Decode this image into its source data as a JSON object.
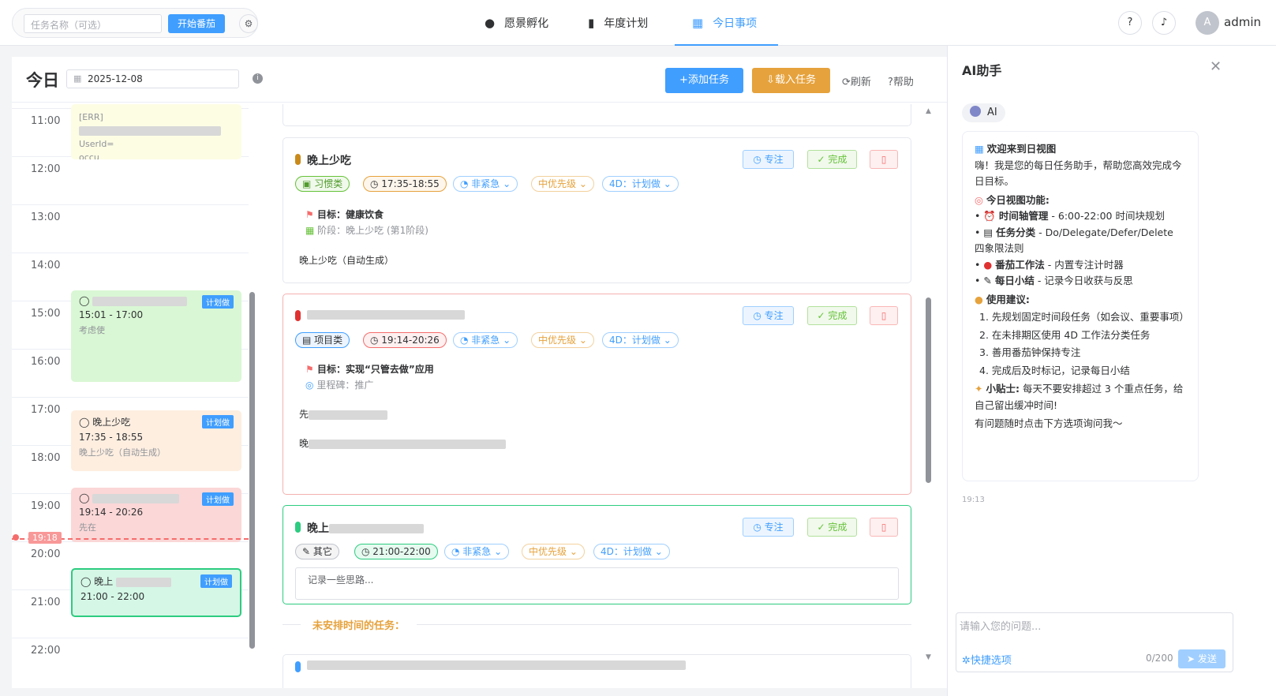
{
  "topbar": {
    "task_placeholder": "任务名称（可选）",
    "start_button": "开始番茄",
    "nav": [
      {
        "label": "愿景孵化",
        "icon": "bulb-icon"
      },
      {
        "label": "年度计划",
        "icon": "clipboard-icon"
      },
      {
        "label": "今日事项",
        "icon": "calendar-icon"
      }
    ],
    "help_icon": "?",
    "bell_icon": "🔔",
    "avatar": "A",
    "username": "admin"
  },
  "header": {
    "title": "今日",
    "date": "2025-12-08",
    "add_task": "+添加任务",
    "load_task": "⇩载入任务",
    "refresh": "刷新",
    "help": "帮助"
  },
  "timeline": {
    "hours": [
      "11:00",
      "12:00",
      "13:00",
      "14:00",
      "15:00",
      "16:00",
      "17:00",
      "18:00",
      "19:00",
      "20:00",
      "21:00",
      "22:00"
    ],
    "now": "19:18",
    "events": [
      {
        "title": "[ERR]",
        "time": "UserId=",
        "desc": "occu",
        "badge": ""
      },
      {
        "title": "",
        "time": "15:01 - 17:00",
        "desc": "考虑使",
        "badge": "计划做"
      },
      {
        "title": "晚上少吃",
        "time": "17:35 - 18:55",
        "desc": "晚上少吃（自动生成）",
        "badge": "计划做"
      },
      {
        "title": "",
        "time": "19:14 - 20:26",
        "desc": "先在",
        "badge": "计划做"
      },
      {
        "title": "晚上",
        "time": "21:00 - 22:00",
        "desc": "",
        "badge": "计划做"
      }
    ]
  },
  "cards": [
    {
      "title": "晚上少吃",
      "cat": "习惯类",
      "time": "17:35-18:55",
      "urg": "非紧急",
      "pri": "中优先级",
      "d4": "4D：计划做",
      "goal": "目标：健康饮食",
      "sub": "阶段：晚上少吃 (第1阶段)",
      "desc": "晚上少吃（自动生成）"
    },
    {
      "title": "",
      "cat": "项目类",
      "time": "19:14-20:26",
      "urg": "非紧急",
      "pri": "中优先级",
      "d4": "4D：计划做",
      "goal": "目标：实现“只管去做”应用",
      "sub": "里程碑：推广",
      "desc": "先",
      "desc2": "晚"
    },
    {
      "title": "晚上",
      "cat": "其它",
      "time": "21:00-22:00",
      "urg": "非紧急",
      "pri": "中优先级",
      "d4": "4D：计划做",
      "placeholder": "记录一些思路..."
    }
  ],
  "actions": {
    "focus": "专注",
    "done": "完成",
    "delete_icon": "🗑"
  },
  "unscheduled": "未安排时间的任务：",
  "ai": {
    "title": "AI助手",
    "badge": "AI",
    "time": "19:13",
    "input_placeholder": "请输入您的问题...",
    "quick": "快捷选项",
    "count": "0/200",
    "send": "发送",
    "msg": {
      "h1": "欢迎来到日视图",
      "intro": "嗨！我是您的每日任务助手，帮助您高效完成今日目标。",
      "h2": "今日视图功能:",
      "f1b": "时间轴管理",
      "f1": " - 6:00-22:00 时间块规划",
      "f2b": "任务分类",
      "f2": " - Do/Delegate/Defer/Delete 四象限法则",
      "f3b": "番茄工作法",
      "f3": " - 内置专注计时器",
      "f4b": "每日小结",
      "f4": " - 记录今日收获与反思",
      "h3": "使用建议:",
      "s1": "1. 先规划固定时间段任务（如会议、重要事项）",
      "s2": "2. 在未排期区使用 4D 工作法分类任务",
      "s3": "3. 善用番茄钟保持专注",
      "s4": "4. 完成后及时标记，记录每日小结",
      "tipb": "小贴士:",
      "tip": " 每天不要安排超过 3 个重点任务，给自己留出缓冲时间!",
      "end": "有问题随时点击下方选项询问我～"
    }
  }
}
